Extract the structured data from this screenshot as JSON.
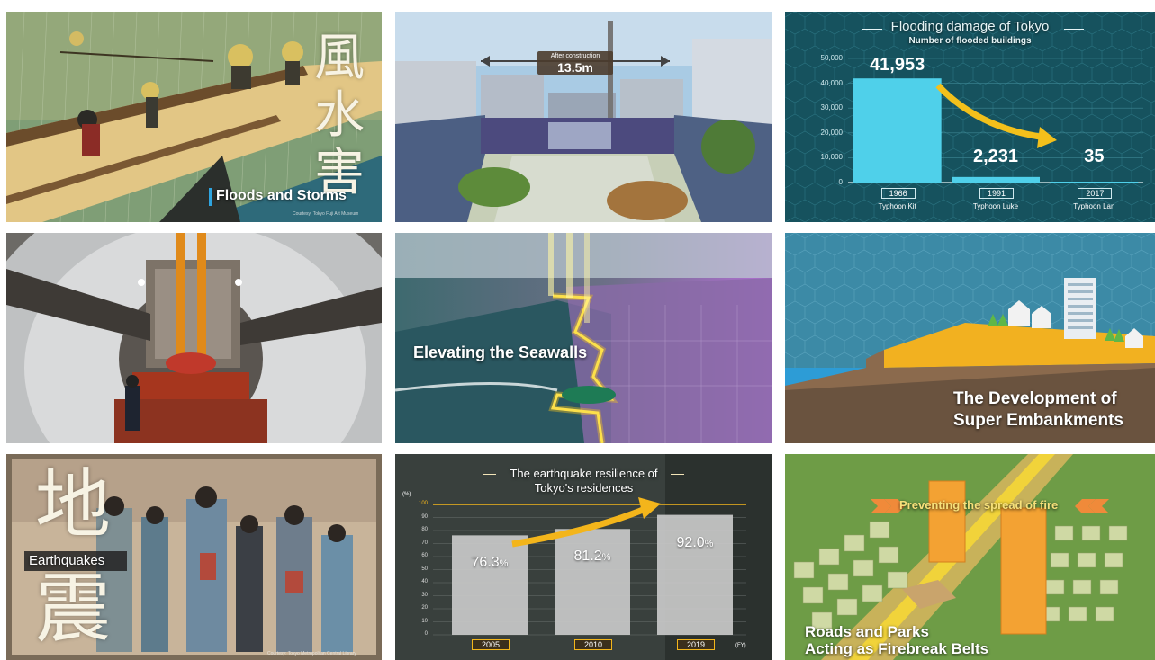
{
  "tiles": {
    "floods": {
      "kanji": [
        "風",
        "水",
        "害"
      ],
      "caption": "Floods and Storms",
      "credit": "Courtesy: Tokyo Fuji Art Museum"
    },
    "river": {
      "label_top": "After construction",
      "label_value": "13.5m"
    },
    "flood_chart": {
      "title": "Flooding damage of Tokyo",
      "subtitle": "Number of flooded buildings",
      "chart_data": {
        "type": "bar",
        "categories": [
          "1966",
          "1991",
          "2017"
        ],
        "category_sublabels": [
          "Typhoon Kit",
          "Typhoon Luke",
          "Typhoon Lan"
        ],
        "values": [
          41953,
          2231,
          35
        ],
        "value_labels": [
          "41,953",
          "2,231",
          "35"
        ],
        "yticks": [
          "50,000",
          "40,000",
          "30,000",
          "20,000",
          "10,000",
          "0"
        ],
        "ylim": [
          0,
          50000
        ],
        "title": "Flooding damage of Tokyo",
        "subtitle": "Number of flooded buildings",
        "colors": {
          "bar": "#4fd0ea",
          "arrow": "#f3c01b",
          "bg": "#16525e"
        }
      }
    },
    "tunnel": {},
    "seawalls": {
      "caption": "Elevating the Seawalls"
    },
    "embankments": {
      "caption_line1": "The Development of",
      "caption_line2": "Super Embankments"
    },
    "earthquakes": {
      "kanji": [
        "地",
        "震"
      ],
      "caption": "Earthquakes",
      "credit": "Courtesy: Tokyo Metropolitan Central Library"
    },
    "quake_chart": {
      "title_line1": "The earthquake resilience of",
      "title_line2": "Tokyo's residences",
      "chart_data": {
        "type": "bar",
        "categories": [
          "2005",
          "2010",
          "2019"
        ],
        "values": [
          76.3,
          81.2,
          92.0
        ],
        "value_labels": [
          "76.3",
          "81.2",
          "92.0"
        ],
        "value_unit": "%",
        "yticks": [
          "100",
          "90",
          "80",
          "70",
          "60",
          "50",
          "40",
          "30",
          "20",
          "10",
          "0"
        ],
        "ylim": [
          0,
          100
        ],
        "y_unit": "(%)",
        "x_unit": "(FY)",
        "title": "The earthquake resilience of Tokyo's residences",
        "colors": {
          "bar": "#c9c9c9",
          "arrow": "#f3b51b",
          "target": "#f3b51b"
        }
      }
    },
    "firebreak": {
      "banner": "Preventing the spread of fire",
      "caption_line1": "Roads and Parks",
      "caption_line2": "Acting as Firebreak Belts"
    }
  }
}
